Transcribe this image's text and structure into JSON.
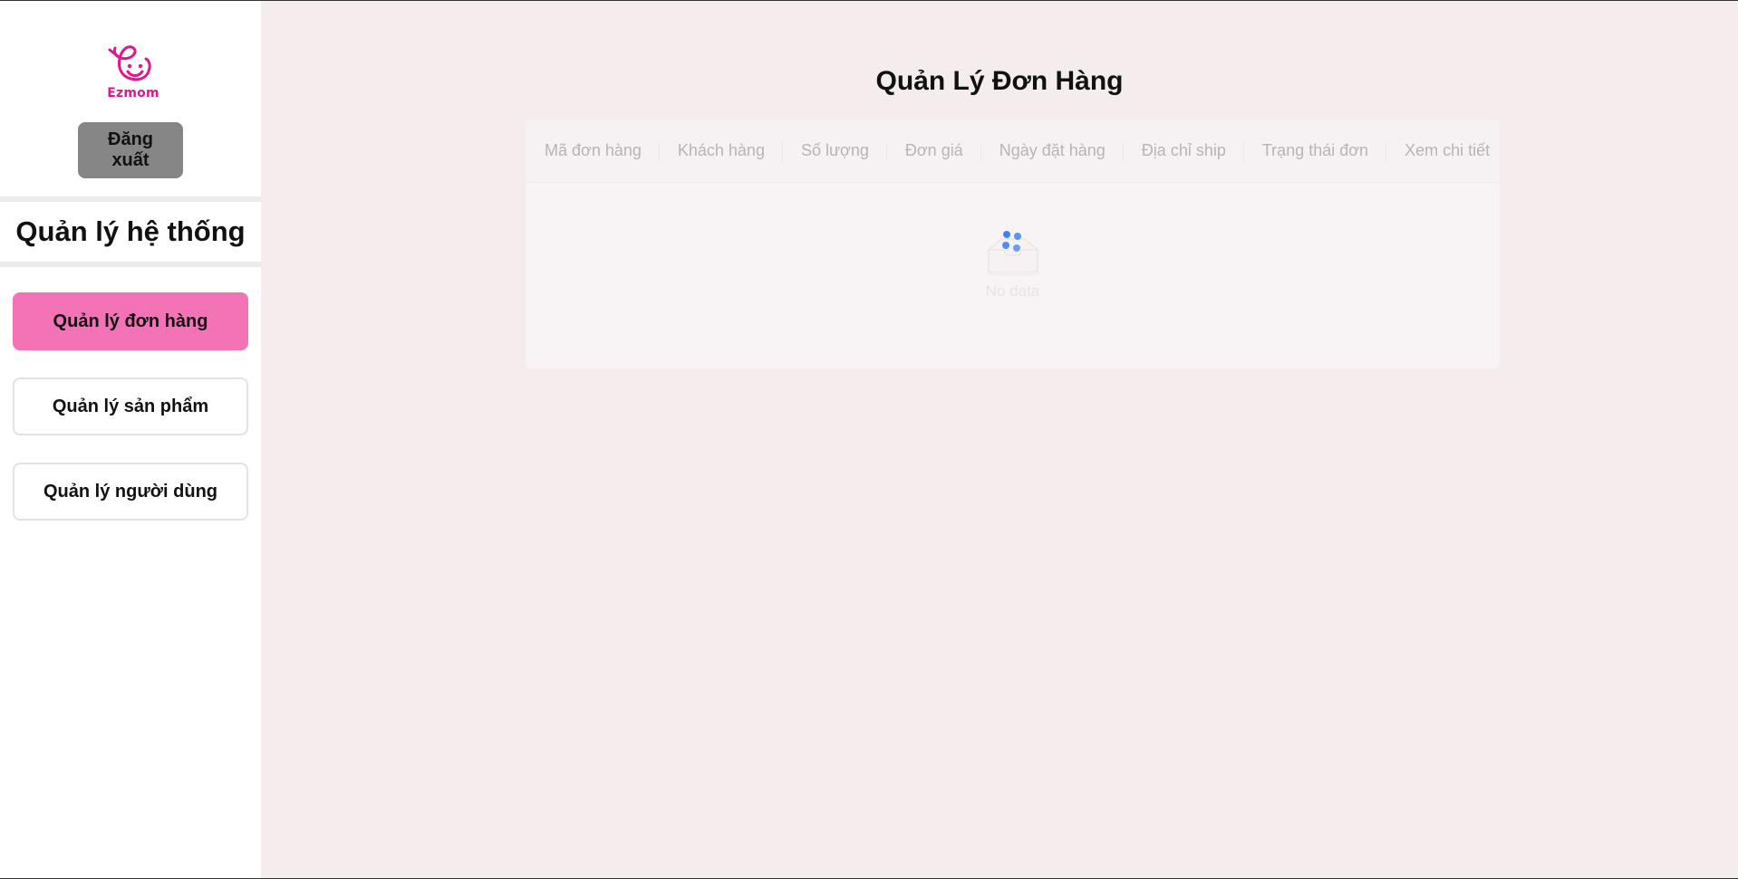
{
  "sidebar": {
    "logo_text": "Ezmom",
    "logout_label": "Đăng xuất",
    "section_title": "Quản lý hệ thống",
    "items": [
      {
        "label": "Quản lý đơn hàng",
        "active": true
      },
      {
        "label": "Quản lý sản phẩm",
        "active": false
      },
      {
        "label": "Quản lý người dùng",
        "active": false
      }
    ]
  },
  "main": {
    "title": "Quản Lý Đơn Hàng",
    "table": {
      "columns": [
        "Mã đơn hàng",
        "Khách hàng",
        "Số lượng",
        "Đơn giá",
        "Ngày đặt hàng",
        "Địa chỉ ship",
        "Trạng thái đơn",
        "Xem chi tiết"
      ],
      "rows": [],
      "empty_text": "No data"
    }
  },
  "colors": {
    "accent": "#f472b6",
    "logo": "#e0188f",
    "spinner": "#3b82f6",
    "background": "#f5ecee"
  }
}
